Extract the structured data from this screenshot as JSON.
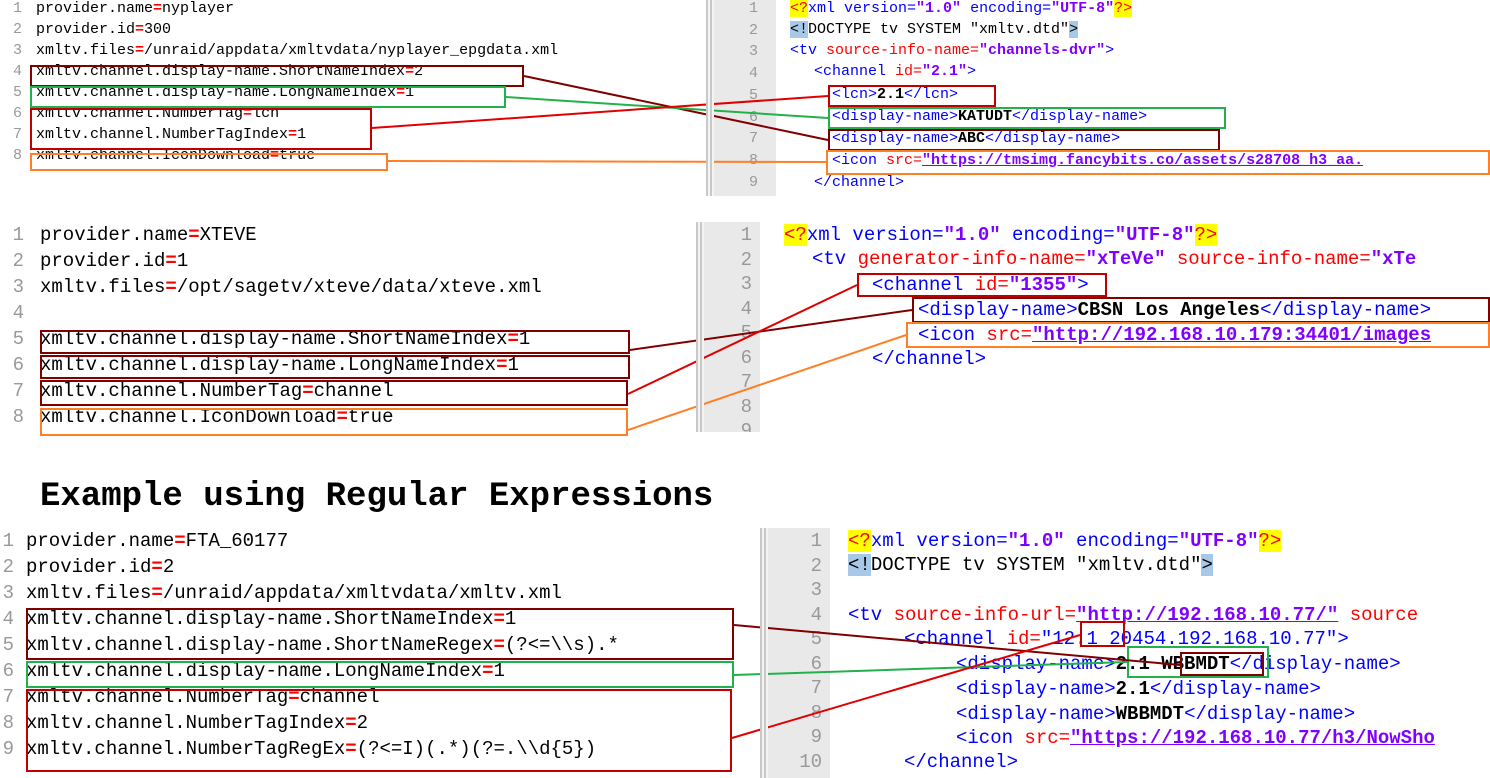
{
  "panel1_left": {
    "lines": [
      {
        "n": "1",
        "key": "provider.name",
        "val": "nyplayer"
      },
      {
        "n": "2",
        "key": "provider.id",
        "val": "300"
      },
      {
        "n": "3",
        "key": "xmltv.files",
        "val": "/unraid/appdata/xmltvdata/nyplayer_epgdata.xml"
      },
      {
        "n": "4",
        "key": "xmltv.channel.display-name.ShortNameIndex",
        "val": "2"
      },
      {
        "n": "5",
        "key": "xmltv.channel.display-name.LongNameIndex",
        "val": "1"
      },
      {
        "n": "6",
        "key": "xmltv.channel.NumberTag",
        "val": "lcn"
      },
      {
        "n": "7",
        "key": "xmltv.channel.NumberTagIndex",
        "val": "1"
      },
      {
        "n": "8",
        "key": "xmltv.channel.IconDownload",
        "val": "true"
      }
    ]
  },
  "panel1_right": {
    "lines": [
      "1",
      "2",
      "3",
      "4",
      "5",
      "6",
      "7",
      "8",
      "9"
    ],
    "l1": {
      "a": "xml version=",
      "b": "\"1.0\"",
      "c": " encoding=",
      "d": "\"UTF-8\""
    },
    "l2": {
      "a": "DOCTYPE tv SYSTEM \"xmltv.dtd\""
    },
    "l3": {
      "tag": "<tv ",
      "attr": "source-info-name=",
      "val": "\"channels-dvr\"",
      "end": ">"
    },
    "l4": {
      "tag": "<channel ",
      "attr": "id=",
      "val": "\"2.1\"",
      "end": ">"
    },
    "l5": {
      "open": "<lcn>",
      "text": "2.1",
      "close": "</lcn>"
    },
    "l6": {
      "open": "<display-name>",
      "text": "KATUDT",
      "close": "</display-name>"
    },
    "l7": {
      "open": "<display-name>",
      "text": "ABC",
      "close": "</display-name>"
    },
    "l8": {
      "tag": "<icon ",
      "attr": "src=",
      "val": "\"https://tmsimg.fancybits.co/assets/s28708_h3_aa."
    },
    "l9": {
      "close": "</channel>"
    }
  },
  "panel2_left": {
    "lines": [
      {
        "n": "1",
        "key": "provider.name",
        "val": "XTEVE"
      },
      {
        "n": "2",
        "key": "provider.id",
        "val": "1"
      },
      {
        "n": "3",
        "key": "xmltv.files",
        "val": "/opt/sagetv/xteve/data/xteve.xml"
      },
      {
        "n": "4",
        "key": "",
        "val": ""
      },
      {
        "n": "5",
        "key": "xmltv.channel.display-name.ShortNameIndex",
        "val": "1"
      },
      {
        "n": "6",
        "key": "xmltv.channel.display-name.LongNameIndex",
        "val": "1"
      },
      {
        "n": "7",
        "key": "xmltv.channel.NumberTag",
        "val": "channel"
      },
      {
        "n": "8",
        "key": "xmltv.channel.IconDownload",
        "val": "true"
      }
    ]
  },
  "panel2_right": {
    "lines": [
      "1",
      "2",
      "3",
      "4",
      "5",
      "6",
      "7",
      "8",
      "9"
    ],
    "l1": {
      "a": "xml version=",
      "b": "\"1.0\"",
      "c": " encoding=",
      "d": "\"UTF-8\""
    },
    "l2": {
      "tag": "<tv ",
      "attr": "generator-info-name=",
      "val": "\"xTeVe\"",
      "attr2": " source-info-name=",
      "val2": "\"xTe"
    },
    "l3": {
      "tag": "<channel ",
      "attr": "id=",
      "val": "\"1355\"",
      "end": ">"
    },
    "l4": {
      "open": "<display-name>",
      "text": "CBSN Los Angeles",
      "close": "</display-name>"
    },
    "l5": {
      "tag": "<icon ",
      "attr": "src=",
      "val": "\"http://192.168.10.179:34401/images"
    },
    "l6": {
      "close": "</channel>"
    }
  },
  "heading": "Example using Regular Expressions",
  "panel3_left": {
    "lines": [
      {
        "n": "1",
        "key": "provider.name",
        "val": "FTA_60177"
      },
      {
        "n": "2",
        "key": "provider.id",
        "val": "2"
      },
      {
        "n": "3",
        "key": "xmltv.files",
        "val": "/unraid/appdata/xmltvdata/xmltv.xml"
      },
      {
        "n": "4",
        "key": "xmltv.channel.display-name.ShortNameIndex",
        "val": "1"
      },
      {
        "n": "5",
        "key": "xmltv.channel.display-name.ShortNameRegex",
        "val": "(?<=\\\\s).*"
      },
      {
        "n": "6",
        "key": "xmltv.channel.display-name.LongNameIndex",
        "val": "1"
      },
      {
        "n": "7",
        "key": "xmltv.channel.NumberTag",
        "val": "channel"
      },
      {
        "n": "8",
        "key": "xmltv.channel.NumberTagIndex",
        "val": "2"
      },
      {
        "n": "9",
        "key": "xmltv.channel.NumberTagRegEx",
        "val": "(?<=I)(.*)(?=.\\\\d{5})"
      }
    ]
  },
  "panel3_right": {
    "lines": [
      "1",
      "2",
      "3",
      "4",
      "5",
      "6",
      "7",
      "8",
      "9",
      "10"
    ],
    "l1": {
      "a": "xml version=",
      "b": "\"1.0\"",
      "c": " encoding=",
      "d": "\"UTF-8\""
    },
    "l2": {
      "a": "DOCTYPE tv SYSTEM \"xmltv.dtd\""
    },
    "l4": {
      "tag": "<tv ",
      "attr": "source-info-url=",
      "val": "\"http://192.168.10.77/\"",
      "attr2": " source"
    },
    "l5": {
      "tag": "<channel ",
      "attr": "id=",
      "q": "\"",
      "v1": "12.1",
      "v2": " 20454.192.168.10.77\"",
      "end": ">"
    },
    "l6": {
      "open": "<display-name>",
      "t1": "2.1 ",
      "t2": "WBBMDT",
      "close": "</display-name>"
    },
    "l7": {
      "open": "<display-name>",
      "text": "2.1",
      "close": "</display-name>"
    },
    "l8": {
      "open": "<display-name>",
      "text": "WBBMDT",
      "close": "</display-name>"
    },
    "l9": {
      "tag": "<icon ",
      "attr": "src=",
      "val": "\"https://192.168.10.77/h3/NowSho"
    },
    "l10": {
      "close": "</channel>"
    }
  },
  "colors": {
    "red": "#c00000",
    "dark_red": "#800000",
    "green": "#22b14c",
    "orange": "#ff7f27"
  }
}
